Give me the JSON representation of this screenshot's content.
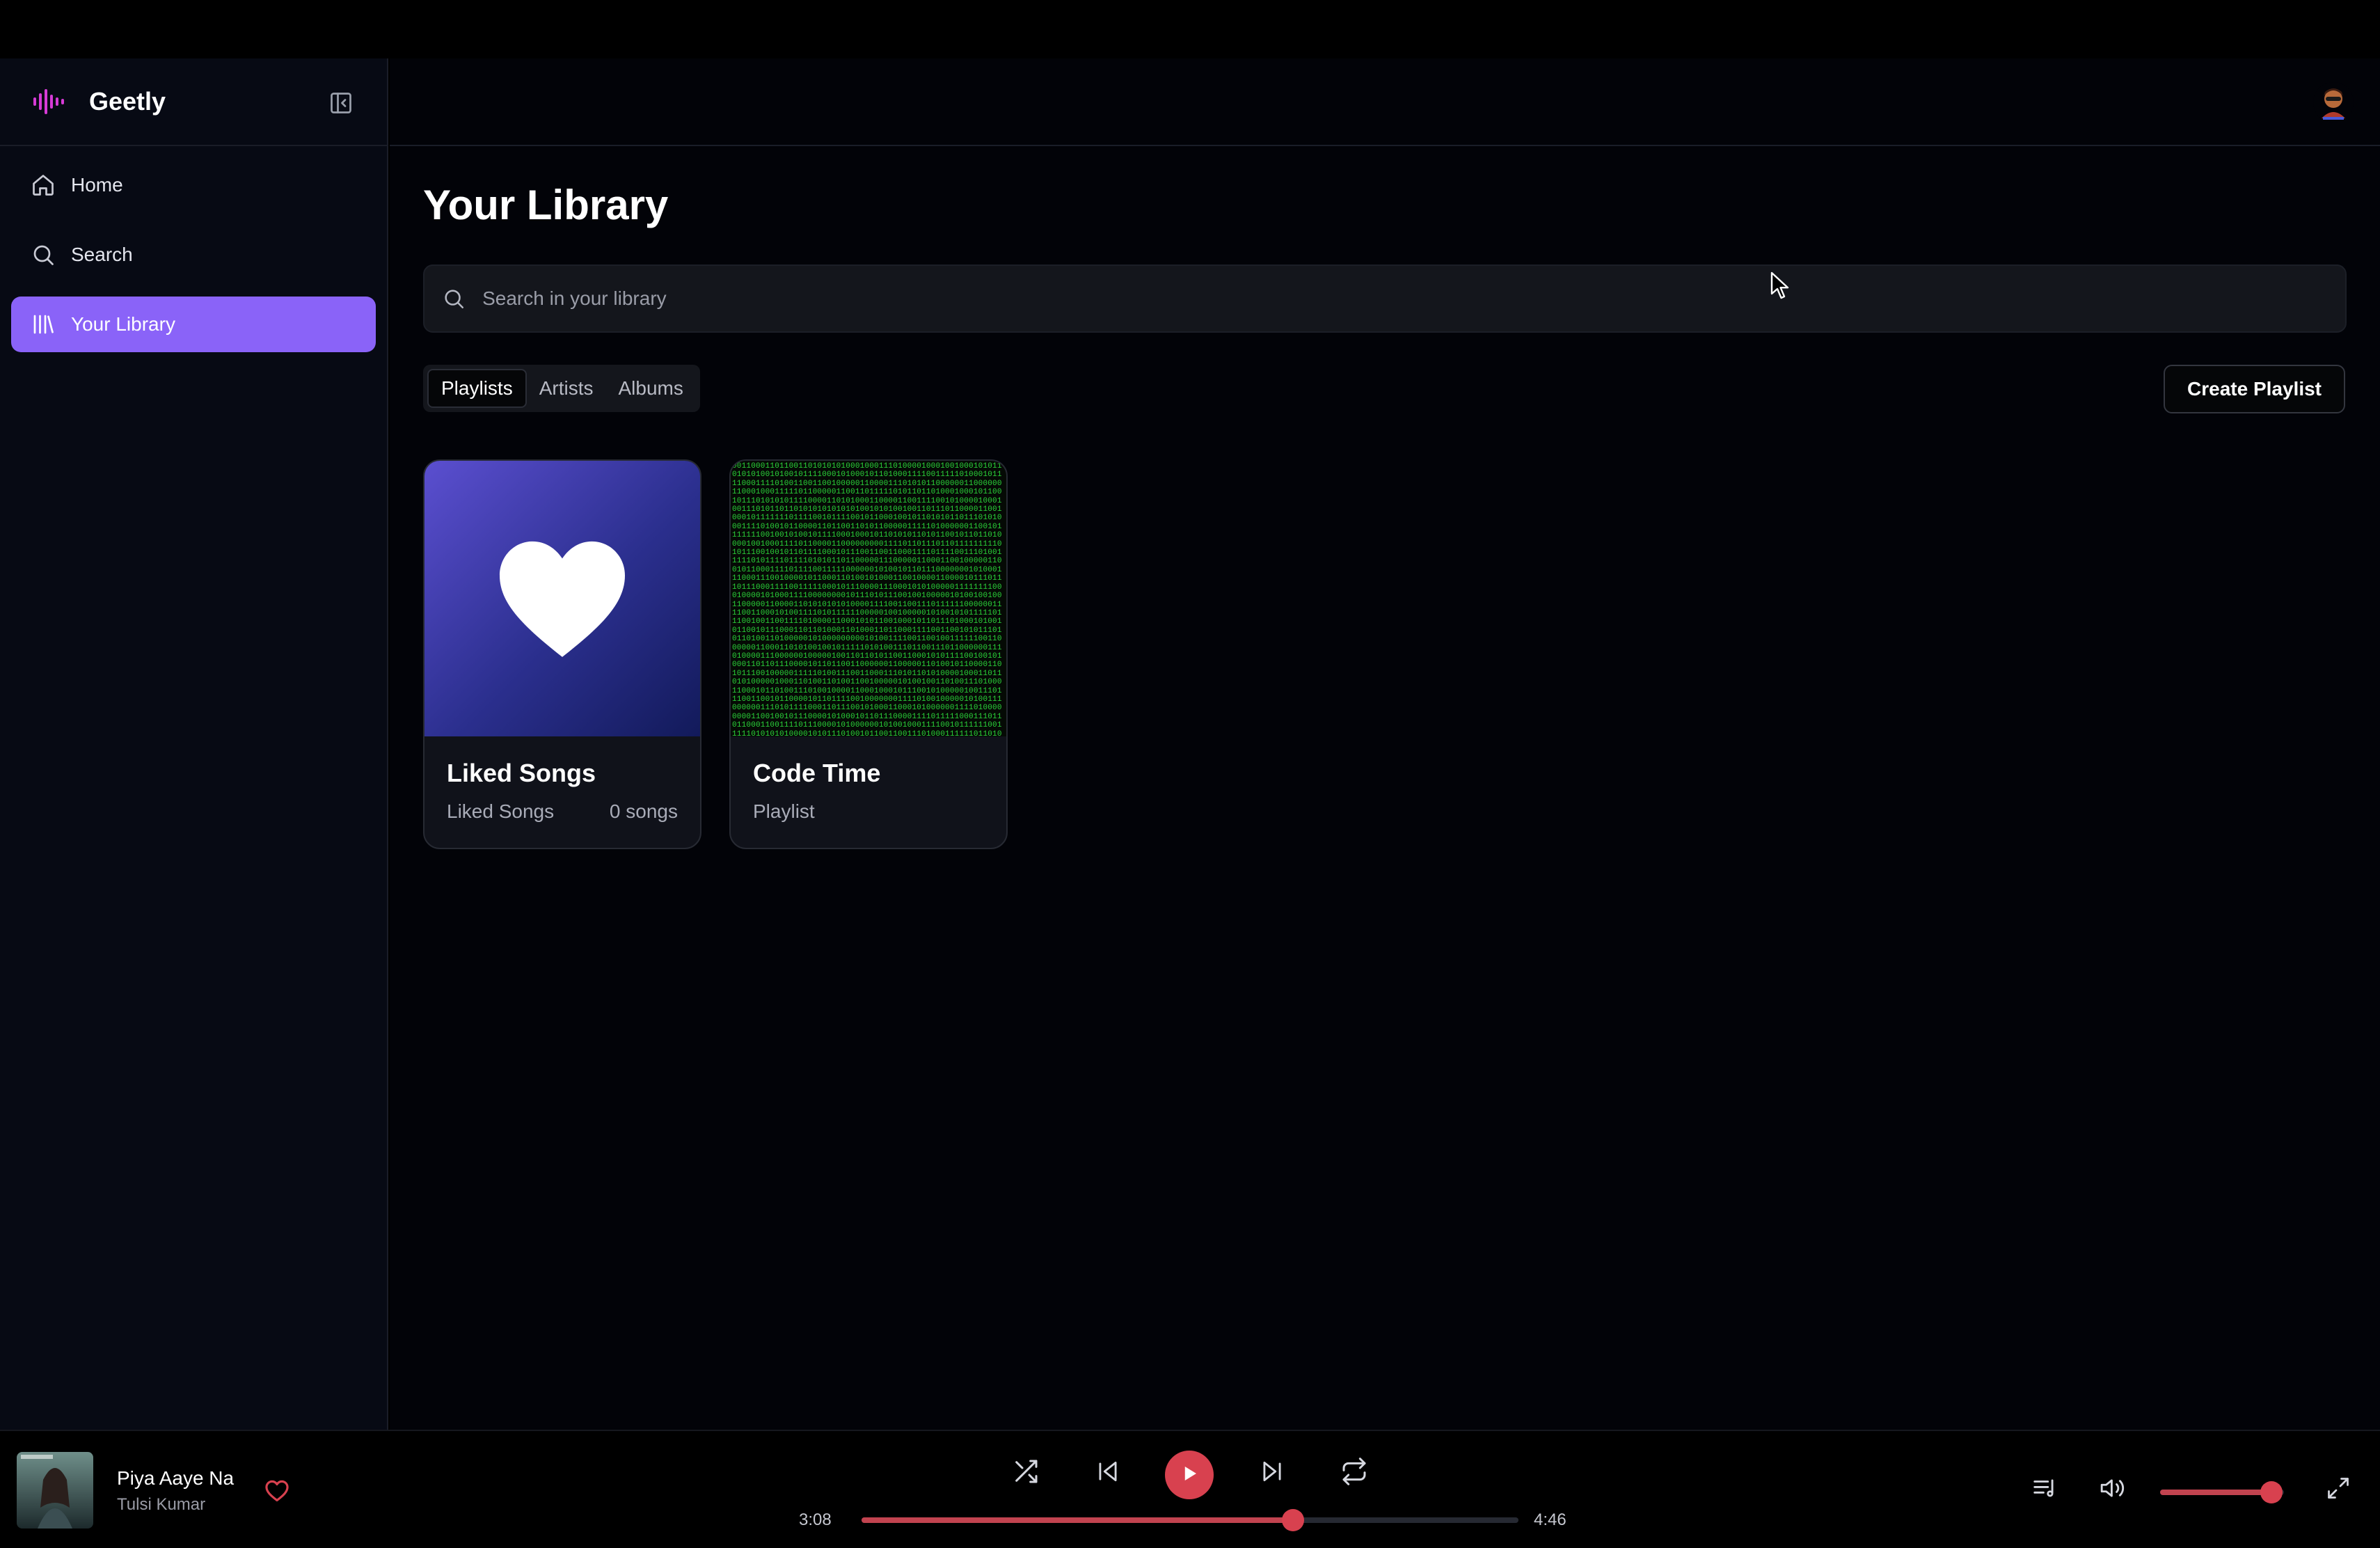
{
  "app": {
    "name": "Geetly",
    "accent": "#8a63f8",
    "player_accent": "#d8414f"
  },
  "sidebar": {
    "items": [
      {
        "label": "Home",
        "icon": "home-icon",
        "active": false
      },
      {
        "label": "Search",
        "icon": "search-icon",
        "active": false
      },
      {
        "label": "Your Library",
        "icon": "library-icon",
        "active": true
      }
    ]
  },
  "library": {
    "title": "Your Library",
    "search_placeholder": "Search in your library",
    "tabs": [
      {
        "label": "Playlists",
        "active": true
      },
      {
        "label": "Artists",
        "active": false
      },
      {
        "label": "Albums",
        "active": false
      }
    ],
    "create_label": "Create Playlist",
    "cards": [
      {
        "title": "Liked Songs",
        "subtitle": "Liked Songs",
        "count": "0 songs",
        "cover": "heart-icon"
      },
      {
        "title": "Code Time",
        "subtitle": "Playlist",
        "count": "",
        "cover": "binary-matrix"
      }
    ]
  },
  "player": {
    "track_title": "Piya Aaye Na",
    "track_artist": "Tulsi Kumar",
    "current_time": "3:08",
    "total_time": "4:46",
    "progress": 0.6573,
    "volume": 0.9
  }
}
